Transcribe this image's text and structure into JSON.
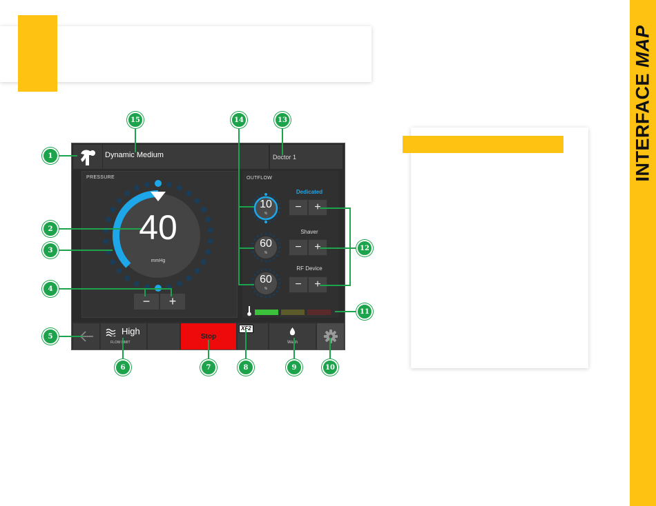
{
  "page": {
    "side_title_plain": "INTERFACE ",
    "side_title_italic": "MAP",
    "accent_color": "#fdc212",
    "callout_color": "#1da34b"
  },
  "screen": {
    "mode_icon": "shoulder-joint-icon",
    "mode_label": "Dynamic Medium",
    "user_label": "Doctor 1",
    "pressure": {
      "section_label": "PRESSURE",
      "value": "40",
      "unit": "mmHg",
      "setpoint_fraction": 0.4,
      "decrease_label": "−",
      "increase_label": "+",
      "arc_color": "#1ea7e8"
    },
    "outflow": {
      "section_label": "OUTFLOW",
      "channels": [
        {
          "label": "Dedicated",
          "value": "10",
          "unit": "%",
          "active": true,
          "decrease_label": "−",
          "increase_label": "+"
        },
        {
          "label": "Shaver",
          "value": "60",
          "unit": "%",
          "active": false,
          "decrease_label": "−",
          "increase_label": "+"
        },
        {
          "label": "RF Device",
          "value": "60",
          "unit": "%",
          "active": false,
          "decrease_label": "−",
          "increase_label": "+"
        }
      ]
    },
    "temperature": {
      "icon": "thermometer-icon",
      "segments": [
        "#3cc13b",
        "#5a5a2a",
        "#5a2a2a"
      ]
    },
    "bottom_bar": {
      "back_icon": "back-arrow-icon",
      "flow_limit_value": "High",
      "flow_limit_label": "FLOW LIMIT",
      "flow_icon": "waves-icon",
      "stop_label": "Stop",
      "stop_color": "#ee0a0a",
      "xf2_label": "XF2",
      "wash_label": "Wash",
      "wash_icon": "droplet-icon",
      "settings_icon": "gear-icon"
    }
  },
  "callouts": [
    "1",
    "2",
    "3",
    "4",
    "5",
    "6",
    "7",
    "8",
    "9",
    "10",
    "11",
    "12",
    "13",
    "14",
    "15"
  ]
}
